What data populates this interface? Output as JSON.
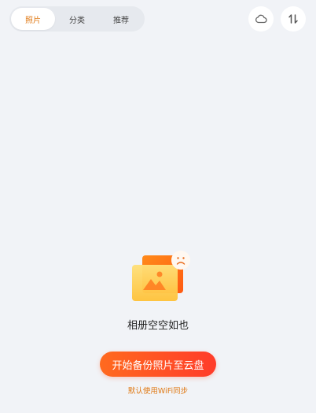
{
  "tabs": [
    {
      "label": "照片",
      "active": true
    },
    {
      "label": "分类",
      "active": false
    },
    {
      "label": "推荐",
      "active": false
    }
  ],
  "header": {
    "cloud_icon": "cloud-icon",
    "sort_icon": "sort-arrows-icon"
  },
  "empty_state": {
    "illustration": "photo-album-sad-icon",
    "message": "相册空空如也",
    "button_label": "开始备份照片至云盘",
    "note": "默认使用WiFi同步"
  },
  "colors": {
    "accent": "#e07a16",
    "button_gradient_start": "#ff6a1f",
    "button_gradient_end": "#ff3c2a",
    "background": "#f1f3f7"
  }
}
